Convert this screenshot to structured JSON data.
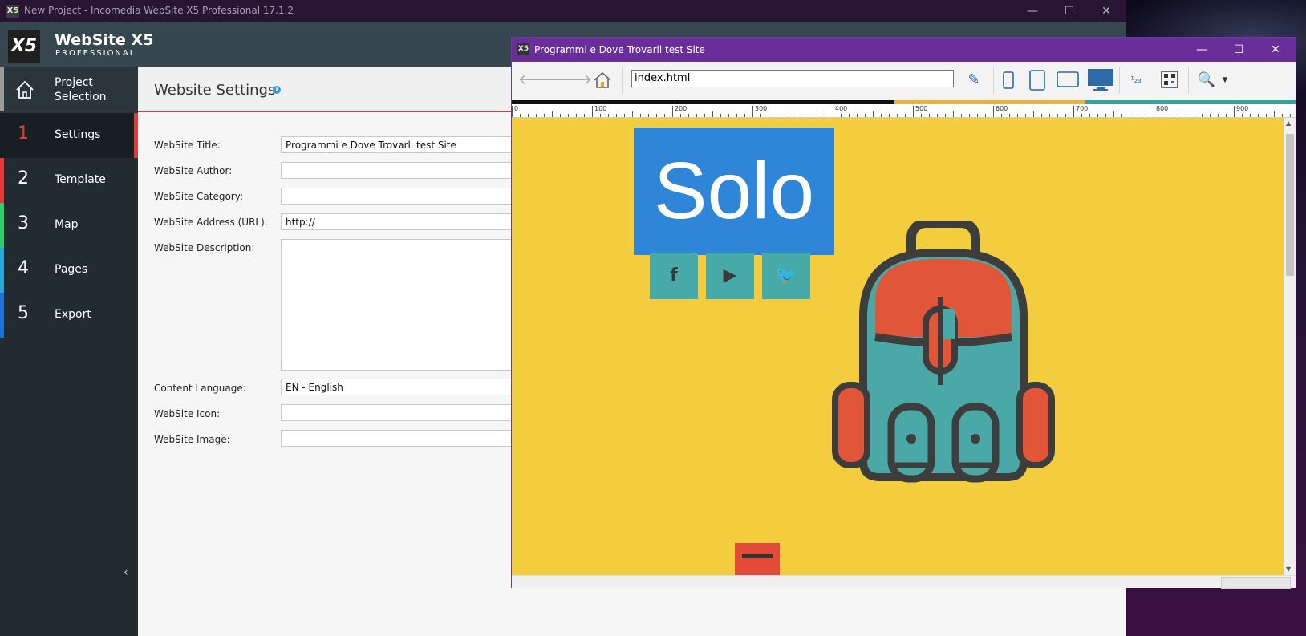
{
  "main_window": {
    "title": "New Project - Incomedia WebSite X5 Professional 17.1.2",
    "brand_name": "WebSite X5",
    "brand_sub": "PROFESSIONAL"
  },
  "sidebar": {
    "home_label": "Project Selection",
    "items": [
      {
        "num": "1",
        "label": "Settings",
        "color": "#e53935"
      },
      {
        "num": "2",
        "label": "Template",
        "color": "#e53935"
      },
      {
        "num": "3",
        "label": "Map",
        "color": "#2ecc71"
      },
      {
        "num": "4",
        "label": "Pages",
        "color": "#2aa7d8"
      },
      {
        "num": "5",
        "label": "Export",
        "color": "#1e6fd8"
      }
    ]
  },
  "content": {
    "title": "Website Settings",
    "fields": [
      {
        "label": "WebSite Title:",
        "value": "Programmi e Dove Trovarli test Site"
      },
      {
        "label": "WebSite Author:",
        "value": ""
      },
      {
        "label": "WebSite Category:",
        "value": ""
      },
      {
        "label": "WebSite Address (URL):",
        "value": "http://"
      },
      {
        "label": "WebSite Description:",
        "value": ""
      },
      {
        "label": "Content Language:",
        "value": "EN - English"
      },
      {
        "label": "WebSite Icon:",
        "value": ""
      },
      {
        "label": "WebSite Image:",
        "value": ""
      }
    ]
  },
  "preview": {
    "title": "Programmi e Dove Trovarli test Site",
    "url": "index.html",
    "ruler_labels": [
      "0",
      "100",
      "200",
      "300",
      "400",
      "500",
      "600",
      "700",
      "800",
      "900"
    ],
    "hero_text": "Solo",
    "social_icons": [
      "facebook-icon",
      "youtube-icon",
      "twitter-icon"
    ],
    "colors": {
      "canvas": "#f4cd3e",
      "hero": "#2f86d8",
      "social": "#48aaa8",
      "accent_red": "#e14b37"
    }
  }
}
